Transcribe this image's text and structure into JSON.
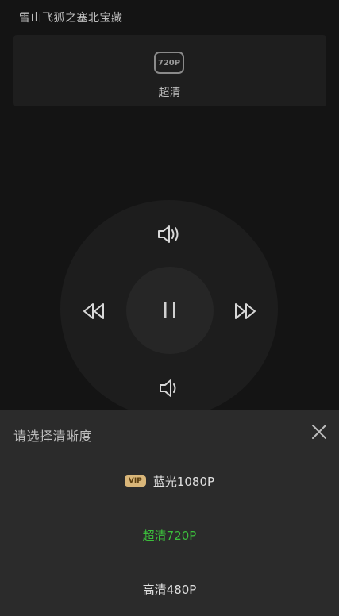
{
  "header": {
    "title": "雪山飞狐之塞北宝藏"
  },
  "current_quality": {
    "badge": "720P",
    "label": "超清"
  },
  "remote": {
    "buttons": [
      "volume-up",
      "rewind",
      "pause",
      "fast-forward",
      "volume-down"
    ]
  },
  "sheet": {
    "title": "请选择清晰度",
    "options": [
      {
        "badge": "VIP",
        "label": "蓝光1080P",
        "selected": false
      },
      {
        "label": "超清720P",
        "selected": true
      },
      {
        "label": "高清480P",
        "selected": false
      }
    ]
  },
  "colors": {
    "background": "#141414",
    "sheet": "#2b2b2b",
    "selected": "#3cbf3c",
    "vip": "#d9b679"
  }
}
